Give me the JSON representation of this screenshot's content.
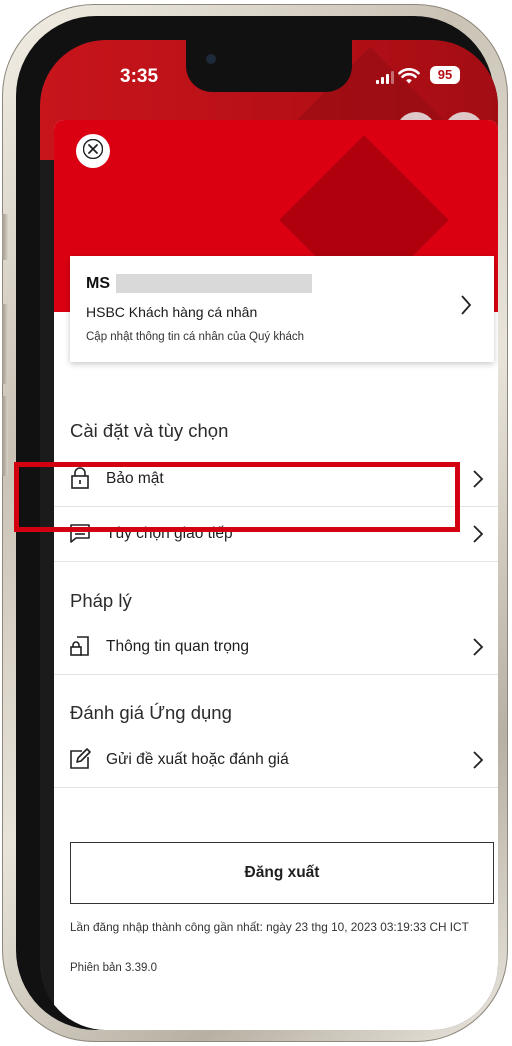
{
  "status_bar": {
    "time": "3:35",
    "battery": "95"
  },
  "close_button": {
    "icon": "close-icon"
  },
  "profile": {
    "prefix": "MS",
    "subtitle": "HSBC Khách hàng cá nhân",
    "hint": "Cập nhật thông tin cá nhân của Quý khách",
    "chevron_icon": "chevron-right-icon"
  },
  "sections": {
    "settings": {
      "title": "Cài đặt và tùy chọn",
      "items": [
        {
          "label": "Bảo mật",
          "icon": "lock-icon"
        },
        {
          "label": "Tùy chọn giao tiếp",
          "icon": "message-icon"
        }
      ]
    },
    "legal": {
      "title": "Pháp lý",
      "items": [
        {
          "label": "Thông tin quan trọng",
          "icon": "document-lock-icon"
        }
      ]
    },
    "rating": {
      "title": "Đánh giá Ứng dụng",
      "items": [
        {
          "label": "Gửi đề xuất hoặc đánh giá",
          "icon": "edit-icon"
        }
      ]
    }
  },
  "logout": {
    "label": "Đăng xuất"
  },
  "footer": {
    "last_login": "Lần đăng nhập thành công gần nhất: ngày 23 thg 10, 2023 03:19:33 CH ICT",
    "version": "Phiên bản 3.39.0"
  },
  "colors": {
    "brand_red": "#db0011",
    "highlight_red": "#d3000f"
  }
}
